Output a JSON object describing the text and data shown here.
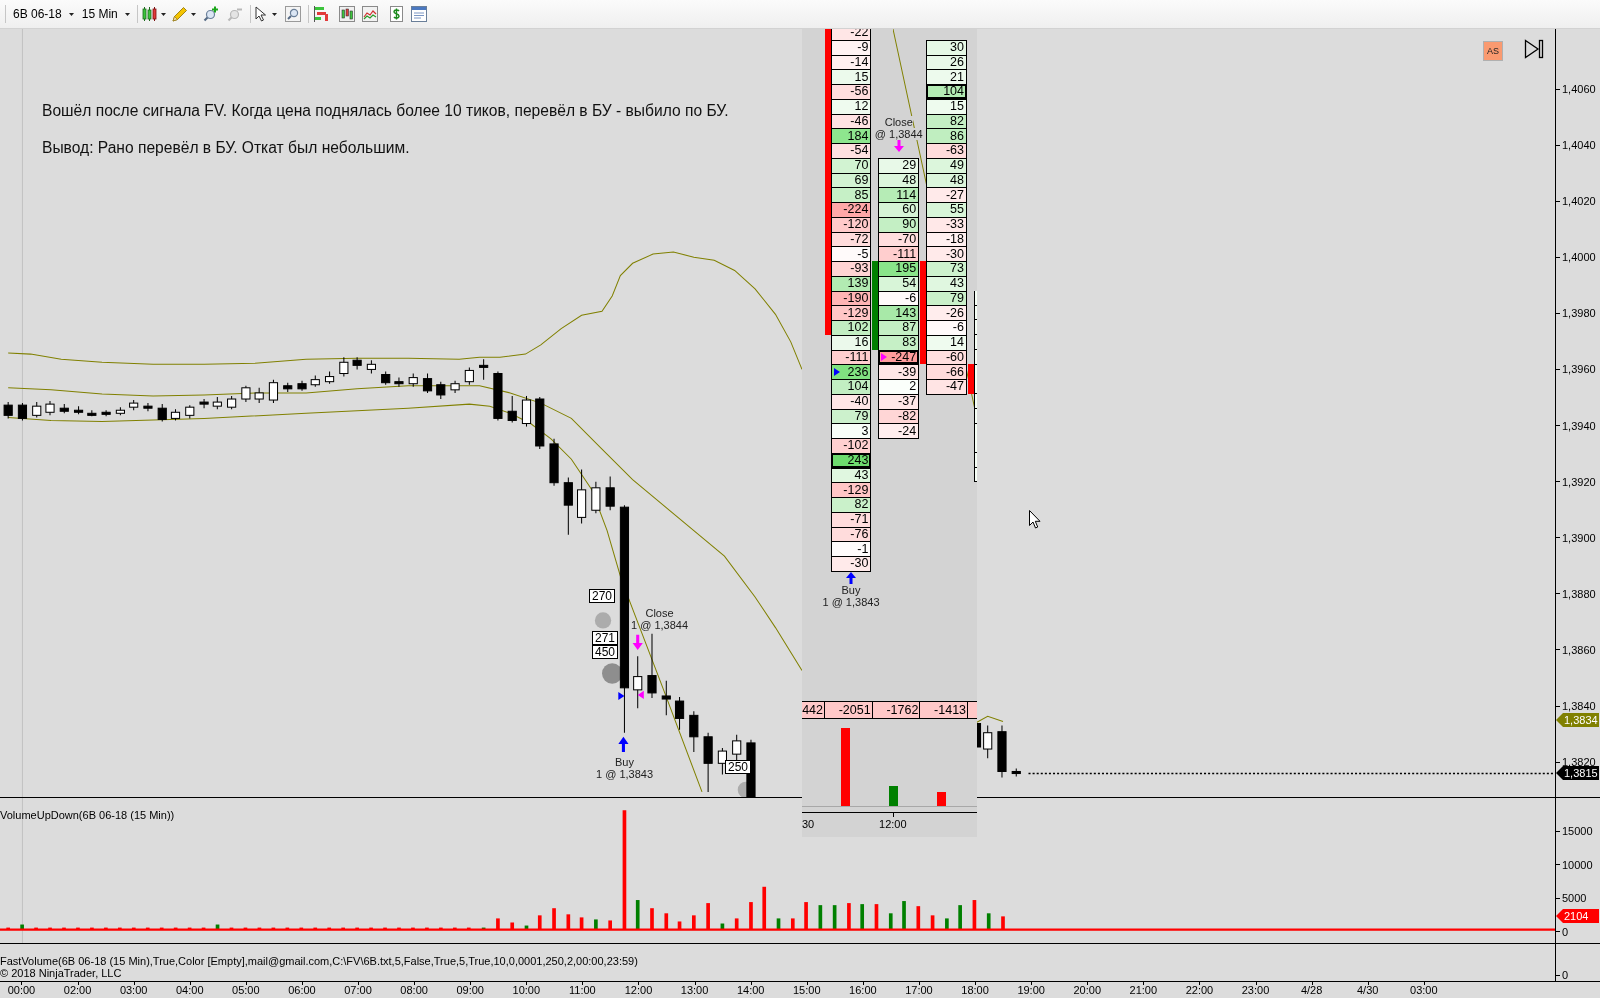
{
  "toolbar": {
    "instrument": "6B 06-18",
    "interval": "15 Min"
  },
  "price_panel": {
    "notes": [
      "Вошёл после сигнала FV. Когда цена поднялась более 10 тиков, перевёл в БУ - выбило по БУ.",
      "Вывод: Рано перевёл в БУ. Откат был небольшим."
    ],
    "auto_scale_button": "AS",
    "volume_labels": [
      "270",
      "271",
      "450",
      "250"
    ],
    "close_marker": {
      "title": "Close",
      "detail": "1 @ 1,3844"
    },
    "buy_marker": {
      "title": "Buy",
      "detail": "1 @ 1,3843"
    },
    "axis": [
      "1,4060",
      "1,4040",
      "1,4020",
      "1,4000",
      "1,3980",
      "1,3960",
      "1,3940",
      "1,3920",
      "1,3900",
      "1,3880",
      "1,3860",
      "1,3840",
      "1,3820"
    ],
    "price_tags": [
      {
        "text": "1,3834",
        "color": "#808000"
      },
      {
        "text": "1,3815",
        "color": "#000000"
      }
    ]
  },
  "footprint_popup": {
    "columns": [
      {
        "color": "#ff0000",
        "label": {
          "kind": "buy",
          "title": "Buy",
          "detail": "1 @ 1,3843"
        },
        "cells": [
          {
            "text": "-22",
            "color": "#ffe6e6",
            "in_body": true,
            "outlined": false
          },
          {
            "text": "-9",
            "color": "#fff3f3",
            "in_body": true,
            "outlined": false
          },
          {
            "text": "-14",
            "color": "#fff0f0",
            "in_body": true,
            "outlined": false
          },
          {
            "text": "15",
            "color": "#ecfaec",
            "in_body": true,
            "outlined": false
          },
          {
            "text": "-56",
            "color": "#ffdede",
            "in_body": true,
            "outlined": false
          },
          {
            "text": "12",
            "color": "#effbef",
            "in_body": true,
            "outlined": false
          },
          {
            "text": "-46",
            "color": "#ffe3e3",
            "in_body": true,
            "outlined": false
          },
          {
            "text": "184",
            "color": "#8ee68e",
            "in_body": true,
            "outlined": false
          },
          {
            "text": "-54",
            "color": "#ffe0e0",
            "in_body": true,
            "outlined": false
          },
          {
            "text": "70",
            "color": "#d2f3d2",
            "in_body": true,
            "outlined": false
          },
          {
            "text": "69",
            "color": "#d2f3d2",
            "in_body": true,
            "outlined": false
          },
          {
            "text": "85",
            "color": "#c6f0c6",
            "in_body": true,
            "outlined": false
          },
          {
            "text": "-224",
            "color": "#ffa8a8",
            "in_body": true,
            "outlined": false
          },
          {
            "text": "-120",
            "color": "#ffcaca",
            "in_body": true,
            "outlined": false
          },
          {
            "text": "-72",
            "color": "#ffdcdc",
            "in_body": true,
            "outlined": false
          },
          {
            "text": "-5",
            "color": "#fffafa",
            "in_body": true,
            "outlined": false
          },
          {
            "text": "-93",
            "color": "#ffd4d4",
            "in_body": true,
            "outlined": false
          },
          {
            "text": "139",
            "color": "#b2ebb2",
            "in_body": true,
            "outlined": false
          },
          {
            "text": "-190",
            "color": "#ffb4b4",
            "in_body": true,
            "outlined": false
          },
          {
            "text": "-129",
            "color": "#ffc6c6",
            "in_body": true,
            "outlined": false
          },
          {
            "text": "102",
            "color": "#c2eec2",
            "in_body": true,
            "outlined": false
          },
          {
            "text": "16",
            "color": "#ebf9eb",
            "in_body": false,
            "outlined": false
          },
          {
            "text": "-111",
            "color": "#ffcece",
            "in_body": false,
            "outlined": false
          },
          {
            "text": "236",
            "color": "#80e280",
            "in_body": false,
            "outlined": false,
            "marker": {
              "color": "#0000ff"
            }
          },
          {
            "text": "104",
            "color": "#c2eec2",
            "in_body": false,
            "outlined": false
          },
          {
            "text": "-40",
            "color": "#ffe6e6",
            "in_body": false,
            "outlined": false
          },
          {
            "text": "79",
            "color": "#ccf1cc",
            "in_body": false,
            "outlined": false
          },
          {
            "text": "3",
            "color": "#f8fef8",
            "in_body": false,
            "outlined": false
          },
          {
            "text": "-102",
            "color": "#ffd0d0",
            "in_body": false,
            "outlined": false
          },
          {
            "text": "243",
            "color": "#6edb6e",
            "in_body": false,
            "outlined": true
          },
          {
            "text": "43",
            "color": "#e0f7e0",
            "in_body": false,
            "outlined": false
          },
          {
            "text": "-129",
            "color": "#ffc6c6",
            "in_body": false,
            "outlined": false
          },
          {
            "text": "82",
            "color": "#caf1ca",
            "in_body": false,
            "outlined": false
          },
          {
            "text": "-71",
            "color": "#ffdcdc",
            "in_body": false,
            "outlined": false
          },
          {
            "text": "-76",
            "color": "#ffdcdc",
            "in_body": false,
            "outlined": false
          },
          {
            "text": "-1",
            "color": "#fffcfc",
            "in_body": false,
            "outlined": false
          },
          {
            "text": "-30",
            "color": "#ffeaea",
            "in_body": false,
            "outlined": false
          }
        ]
      },
      {
        "color": "#008000",
        "label": {
          "kind": "close",
          "title": "Close",
          "detail": "@ 1,3844"
        },
        "cells": [
          {
            "text": "29",
            "color": "#e8f9e8",
            "in_body": false,
            "outlined": false
          },
          {
            "text": "48",
            "color": "#dcf6dc",
            "in_body": false,
            "outlined": false
          },
          {
            "text": "114",
            "color": "#b6ecb6",
            "in_body": false,
            "outlined": false
          },
          {
            "text": "60",
            "color": "#d6f4d6",
            "in_body": false,
            "outlined": false
          },
          {
            "text": "90",
            "color": "#c4efc4",
            "in_body": false,
            "outlined": false
          },
          {
            "text": "-70",
            "color": "#ffdede",
            "in_body": false,
            "outlined": false
          },
          {
            "text": "-111",
            "color": "#ffcece",
            "in_body": false,
            "outlined": false
          },
          {
            "text": "195",
            "color": "#8ae48a",
            "in_body": true,
            "outlined": false
          },
          {
            "text": "54",
            "color": "#d8f5d8",
            "in_body": true,
            "outlined": false
          },
          {
            "text": "-6",
            "color": "#fffafa",
            "in_body": true,
            "outlined": false
          },
          {
            "text": "143",
            "color": "#a8e9a8",
            "in_body": true,
            "outlined": false
          },
          {
            "text": "87",
            "color": "#c4efc4",
            "in_body": true,
            "outlined": false
          },
          {
            "text": "83",
            "color": "#c6f0c6",
            "in_body": true,
            "outlined": false
          },
          {
            "text": "-247",
            "color": "#ff9c9c",
            "in_body": false,
            "outlined": true,
            "marker": {
              "color": "#ff00ff"
            }
          },
          {
            "text": "-39",
            "color": "#ffe6e6",
            "in_body": false,
            "outlined": false
          },
          {
            "text": "2",
            "color": "#fbfffb",
            "in_body": false,
            "outlined": false
          },
          {
            "text": "-37",
            "color": "#ffe8e8",
            "in_body": false,
            "outlined": false
          },
          {
            "text": "-82",
            "color": "#ffd6d6",
            "in_body": false,
            "outlined": false
          },
          {
            "text": "-24",
            "color": "#ffeeee",
            "in_body": false,
            "outlined": false
          }
        ]
      },
      {
        "color": "#ff0000",
        "cells": [
          {
            "text": "30",
            "color": "#e6f9e6",
            "in_body": false,
            "outlined": false
          },
          {
            "text": "26",
            "color": "#e9f9e9",
            "in_body": false,
            "outlined": false
          },
          {
            "text": "21",
            "color": "#edfaed",
            "in_body": false,
            "outlined": false
          },
          {
            "text": "104",
            "color": "#b4ecb4",
            "in_body": false,
            "outlined": true
          },
          {
            "text": "15",
            "color": "#eefbee",
            "in_body": false,
            "outlined": false
          },
          {
            "text": "82",
            "color": "#c4efc4",
            "in_body": false,
            "outlined": false
          },
          {
            "text": "86",
            "color": "#c0eec0",
            "in_body": false,
            "outlined": false
          },
          {
            "text": "-63",
            "color": "#ffdcdc",
            "in_body": false,
            "outlined": false
          },
          {
            "text": "49",
            "color": "#dcf6dc",
            "in_body": false,
            "outlined": false
          },
          {
            "text": "48",
            "color": "#dcf6dc",
            "in_body": false,
            "outlined": false
          },
          {
            "text": "-27",
            "color": "#ffeaea",
            "in_body": false,
            "outlined": false
          },
          {
            "text": "55",
            "color": "#d8f5d8",
            "in_body": false,
            "outlined": false
          },
          {
            "text": "-33",
            "color": "#ffe8e8",
            "in_body": false,
            "outlined": false
          },
          {
            "text": "-18",
            "color": "#fff0f0",
            "in_body": false,
            "outlined": false
          },
          {
            "text": "-30",
            "color": "#ffeaea",
            "in_body": false,
            "outlined": false
          },
          {
            "text": "73",
            "color": "#cef2ce",
            "in_body": true,
            "outlined": false
          },
          {
            "text": "43",
            "color": "#e0f7e0",
            "in_body": true,
            "outlined": false
          },
          {
            "text": "79",
            "color": "#caf1ca",
            "in_body": true,
            "outlined": false
          },
          {
            "text": "-26",
            "color": "#ffeded",
            "in_body": true,
            "outlined": false
          },
          {
            "text": "-6",
            "color": "#fffafa",
            "in_body": true,
            "outlined": false
          },
          {
            "text": "14",
            "color": "#effbef",
            "in_body": true,
            "outlined": false
          },
          {
            "text": "-60",
            "color": "#ffdede",
            "in_body": true,
            "outlined": false
          },
          {
            "text": "-66",
            "color": "#ffdcdc",
            "in_body": false,
            "outlined": false
          },
          {
            "text": "-47",
            "color": "#ffe4e4",
            "in_body": false,
            "outlined": false
          }
        ]
      }
    ],
    "delta_row": [
      "442",
      "-2051",
      "-1762",
      "-1413"
    ],
    "time_axis": [
      "30",
      "12:00"
    ]
  },
  "volume_panel": {
    "title": "VolumeUpDown(6B 06-18 (15 Min))",
    "axis": [
      "15000",
      "10000",
      "5000",
      "0"
    ],
    "tag": {
      "text": "2104",
      "color": "#ff0000"
    }
  },
  "indicator_panel": {
    "lines": [
      "FastVolume(6B 06-18 (15 Min),True,Color [Empty],mail@gmail.com,C:\\FV\\6B.txt,5,False,True,5,True,10,0,0001,250,2,00:00,23:59)",
      "© 2018 NinjaTrader, LLC"
    ],
    "axis": [
      "0"
    ]
  },
  "time_axis": [
    "00:00",
    "02:00",
    "03:00",
    "04:00",
    "05:00",
    "06:00",
    "07:00",
    "08:00",
    "09:00",
    "10:00",
    "11:00",
    "12:00",
    "13:00",
    "14:00",
    "15:00",
    "16:00",
    "17:00",
    "18:00",
    "19:00",
    "20:00",
    "21:00",
    "22:00",
    "23:00",
    "4/28",
    "4/30",
    "03:00"
  ]
}
